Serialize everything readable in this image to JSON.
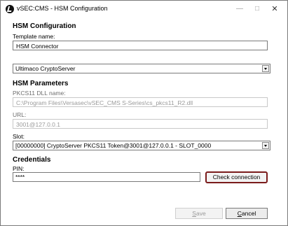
{
  "window": {
    "title": "vSEC:CMS - HSM Configuration"
  },
  "hsm_config": {
    "heading": "HSM Configuration",
    "template_label": "Template name:",
    "template_value": "HSM Connector",
    "provider_selected": "Ultimaco CryptoServer"
  },
  "hsm_params": {
    "heading": "HSM Parameters",
    "dll_label": "PKCS11 DLL name:",
    "dll_value": "C:\\Program Files\\Versasec\\vSEC_CMS S-Series\\cs_pkcs11_R2.dll",
    "url_label": "URL:",
    "url_value": "3001@127.0.0.1",
    "slot_label": "Slot:",
    "slot_selected": "[00000000] CryptoServer PKCS11 Token@3001@127.0.0.1 - SLOT_0000"
  },
  "credentials": {
    "heading": "Credentials",
    "pin_label": "PIN:",
    "pin_value": "****",
    "check_button": "Check connection"
  },
  "footer": {
    "save_button": "Save",
    "cancel_button": "Cancel"
  },
  "icons": {
    "minimize": "minimize-icon",
    "maximize": "maximize-icon",
    "close": "close-icon",
    "dropdown": "chevron-down-icon"
  }
}
